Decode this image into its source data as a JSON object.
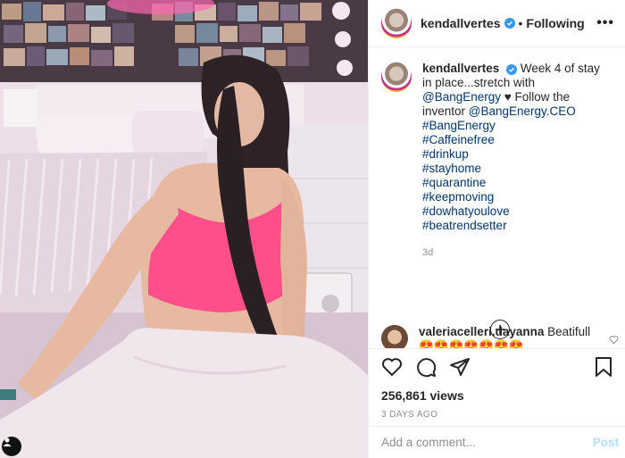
{
  "post": {
    "username": "kendallvertes",
    "separator": "•",
    "follow_status": "Following",
    "more_glyph": "•••"
  },
  "caption": {
    "username": "kendallvertes",
    "text_before": "Week 4 of stay in place...stretch with ",
    "mention_1": "@BangEnergy",
    "text_middle": " ♥ Follow the inventor ",
    "mention_2": "@BangEnergy.CEO",
    "hashtags": [
      "#BangEnergy",
      "#Caffeinefree",
      "#drinkup",
      "#stayhome",
      "#quarantine",
      "#keepmoving",
      "#dowhatyoulove",
      "#beatrendsetter"
    ],
    "age": "3d"
  },
  "comment": {
    "username": "valeriacelleri.dayanna",
    "text": "Beatifull",
    "emojis": "😍😍😍😍😍😍😍"
  },
  "stats": {
    "views": "256,861 views",
    "date": "3 DAYS AGO"
  },
  "composer": {
    "placeholder": "Add a comment...",
    "post_label": "Post"
  },
  "icons": {
    "verified": "verified-badge-icon",
    "like": "heart-icon",
    "comment": "comment-icon",
    "share": "share-icon",
    "save": "bookmark-icon",
    "load_more": "plus-circle-icon",
    "user_tag": "user-tag-icon"
  },
  "colors": {
    "link": "#003569",
    "verified": "#3897f0",
    "post_disabled": "#b2dffc",
    "muted": "#8e8e8e",
    "top_pink": "#ff4f8b"
  }
}
